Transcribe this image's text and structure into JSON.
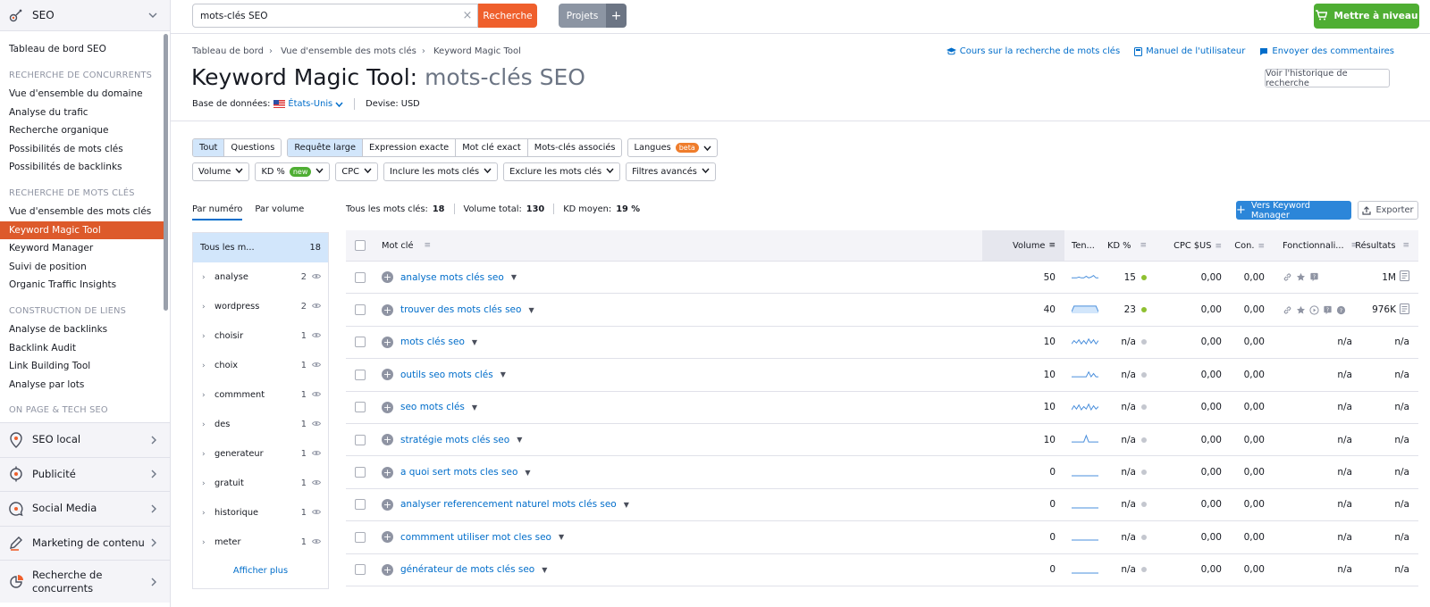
{
  "sidebar": {
    "top": {
      "title": "SEO"
    },
    "items": [
      {
        "type": "item",
        "label": "Tableau de bord SEO"
      },
      {
        "type": "cat",
        "label": "RECHERCHE DE CONCURRENTS"
      },
      {
        "type": "item",
        "label": "Vue d'ensemble du domaine"
      },
      {
        "type": "item",
        "label": "Analyse du trafic"
      },
      {
        "type": "item",
        "label": "Recherche organique"
      },
      {
        "type": "item",
        "label": "Possibilités de mots clés"
      },
      {
        "type": "item",
        "label": "Possibilités de backlinks"
      },
      {
        "type": "cat",
        "label": "RECHERCHE DE MOTS CLÉS"
      },
      {
        "type": "item",
        "label": "Vue d'ensemble des mots clés"
      },
      {
        "type": "item",
        "label": "Keyword Magic Tool",
        "active": true
      },
      {
        "type": "item",
        "label": "Keyword Manager"
      },
      {
        "type": "item",
        "label": "Suivi de position"
      },
      {
        "type": "item",
        "label": "Organic Traffic Insights"
      },
      {
        "type": "cat",
        "label": "CONSTRUCTION DE LIENS"
      },
      {
        "type": "item",
        "label": "Analyse de backlinks"
      },
      {
        "type": "item",
        "label": "Backlink Audit"
      },
      {
        "type": "item",
        "label": "Link Building Tool"
      },
      {
        "type": "item",
        "label": "Analyse par lots"
      },
      {
        "type": "cat",
        "label": "ON PAGE & TECH SEO"
      }
    ],
    "sections": [
      {
        "label": "SEO local",
        "icon": "location-pin-icon"
      },
      {
        "label": "Publicité",
        "icon": "target-icon"
      },
      {
        "label": "Social Media",
        "icon": "chat-bubble-icon"
      },
      {
        "label": "Marketing de contenu",
        "icon": "pen-icon"
      },
      {
        "label": "Recherche de concurrents",
        "icon": "pie-chart-icon"
      }
    ]
  },
  "topbar": {
    "search_value": "mots-clés SEO",
    "clear_symbol": "×",
    "search_button": "Recherche",
    "projects_button": "Projets",
    "projects_add": "+",
    "upgrade_button": "Mettre à niveau"
  },
  "breadcrumb": [
    "Tableau de bord",
    "Vue d'ensemble des mots clés",
    "Keyword Magic Tool"
  ],
  "help_links": [
    {
      "label": "Cours sur la recherche de mots clés"
    },
    {
      "label": "Manuel de l'utilisateur"
    },
    {
      "label": "Envoyer des commentaires"
    }
  ],
  "title": {
    "tool": "Keyword Magic Tool:",
    "query": "mots-clés SEO"
  },
  "history_button": "Voir l'historique de recherche",
  "database": {
    "label": "Base de données:",
    "value": "États-Unis",
    "currency": "Devise: USD"
  },
  "filters": {
    "match_group_1": [
      {
        "label": "Tout",
        "on": true
      },
      {
        "label": "Questions"
      }
    ],
    "match_group_2": [
      {
        "label": "Requête large",
        "on": true
      },
      {
        "label": "Expression exacte"
      },
      {
        "label": "Mot clé exact"
      },
      {
        "label": "Mots-clés associés"
      }
    ],
    "languages": {
      "label": "Langues",
      "badge": "beta"
    },
    "dropdowns": [
      {
        "label": "Volume"
      },
      {
        "label": "KD %",
        "badge": "new"
      },
      {
        "label": "CPC"
      },
      {
        "label": "Inclure les mots clés"
      },
      {
        "label": "Exclure les mots clés"
      },
      {
        "label": "Filtres avancés"
      }
    ]
  },
  "group_tabs": [
    {
      "label": "Par numéro",
      "on": true
    },
    {
      "label": "Par volume"
    }
  ],
  "groups": {
    "head": {
      "label": "Tous les m...",
      "count": "18"
    },
    "rows": [
      {
        "label": "analyse",
        "count": "2"
      },
      {
        "label": "wordpress",
        "count": "2"
      },
      {
        "label": "choisir",
        "count": "1"
      },
      {
        "label": "choix",
        "count": "1"
      },
      {
        "label": "commment",
        "count": "1"
      },
      {
        "label": "des",
        "count": "1"
      },
      {
        "label": "generateur",
        "count": "1"
      },
      {
        "label": "gratuit",
        "count": "1"
      },
      {
        "label": "historique",
        "count": "1"
      },
      {
        "label": "meter",
        "count": "1"
      }
    ],
    "more": "Afficher plus"
  },
  "summary": {
    "all_label": "Tous les mots clés:",
    "all_value": "18",
    "vol_label": "Volume total:",
    "vol_value": "130",
    "kd_label": "KD moyen:",
    "kd_value": "19 %"
  },
  "actions": {
    "keyword_manager": "Vers Keyword Manager",
    "export": "Exporter"
  },
  "table": {
    "headers": {
      "keyword": "Mot clé",
      "volume": "Volume",
      "trend": "Ten...",
      "kd": "KD %",
      "cpc": "CPC $US",
      "com": "Con.",
      "features": "Fonctionnali...",
      "results": "Résultats"
    },
    "rows": [
      {
        "keyword": "analyse mots clés seo",
        "volume": "50",
        "kd": "15",
        "kd_color": "green",
        "cpc": "0,00",
        "com": "0,00",
        "features": [
          "link-icon",
          "star-icon",
          "faq-icon"
        ],
        "results": "1M",
        "trend": [
          0.3,
          0.3,
          0.3,
          0.4,
          0.3,
          0.3,
          0.5,
          0.3,
          0.4,
          0.6,
          0.3,
          0.3
        ]
      },
      {
        "keyword": "trouver des mots clés seo",
        "volume": "40",
        "kd": "23",
        "kd_color": "green",
        "cpc": "0,00",
        "com": "0,00",
        "features": [
          "link-icon",
          "star-icon",
          "play-icon",
          "faq-icon",
          "question-icon"
        ],
        "results": "976K",
        "trend": [
          0.2,
          0.9,
          0.9,
          0.9,
          0.9,
          0.9,
          0.9,
          0.9,
          0.9,
          0.9,
          0.9,
          0.2
        ]
      },
      {
        "keyword": "mots clés seo",
        "volume": "10",
        "kd": "n/a",
        "kd_color": "none",
        "cpc": "0,00",
        "com": "0,00",
        "features": "n/a",
        "results": "n/a",
        "trend": [
          0.2,
          0.6,
          0.3,
          0.7,
          0.2,
          0.6,
          0.2,
          0.8,
          0.3,
          0.7,
          0.2,
          0.6
        ]
      },
      {
        "keyword": "outils seo mots clés",
        "volume": "10",
        "kd": "n/a",
        "kd_color": "none",
        "cpc": "0,00",
        "com": "0,00",
        "features": "n/a",
        "results": "n/a",
        "trend": [
          0.1,
          0.1,
          0.1,
          0.1,
          0.1,
          0.1,
          0.1,
          0.7,
          0.1,
          0.5,
          0.1,
          0.1
        ]
      },
      {
        "keyword": "seo mots clés",
        "volume": "10",
        "kd": "n/a",
        "kd_color": "none",
        "cpc": "0,00",
        "com": "0,00",
        "features": "n/a",
        "results": "n/a",
        "trend": [
          0.1,
          0.6,
          0.2,
          0.7,
          0.1,
          0.5,
          0.2,
          0.8,
          0.1,
          0.6,
          0.2,
          0.5
        ]
      },
      {
        "keyword": "stratégie mots clés seo",
        "volume": "10",
        "kd": "n/a",
        "kd_color": "none",
        "cpc": "0,00",
        "com": "0,00",
        "features": "n/a",
        "results": "n/a",
        "trend": [
          0.1,
          0.1,
          0.1,
          0.1,
          0.1,
          0.1,
          0.9,
          0.1,
          0.1,
          0.1,
          0.1,
          0.1
        ]
      },
      {
        "keyword": "a quoi sert mots cles seo",
        "volume": "0",
        "kd": "n/a",
        "kd_color": "none",
        "cpc": "0,00",
        "com": "0,00",
        "features": "n/a",
        "results": "n/a",
        "trend": [
          0,
          0,
          0,
          0,
          0,
          0,
          0,
          0,
          0,
          0,
          0,
          0
        ]
      },
      {
        "keyword": "analyser referencement naturel mots clés seo",
        "volume": "0",
        "kd": "n/a",
        "kd_color": "none",
        "cpc": "0,00",
        "com": "0,00",
        "features": "n/a",
        "results": "n/a",
        "trend": [
          0,
          0,
          0,
          0,
          0,
          0,
          0,
          0,
          0,
          0,
          0,
          0
        ]
      },
      {
        "keyword": "commment utiliser mot cles seo",
        "volume": "0",
        "kd": "n/a",
        "kd_color": "none",
        "cpc": "0,00",
        "com": "0,00",
        "features": "n/a",
        "results": "n/a",
        "trend": [
          0,
          0,
          0,
          0,
          0,
          0,
          0,
          0,
          0,
          0,
          0,
          0
        ]
      },
      {
        "keyword": "générateur de mots clés seo",
        "volume": "0",
        "kd": "n/a",
        "kd_color": "none",
        "cpc": "0,00",
        "com": "0,00",
        "features": "n/a",
        "results": "n/a",
        "trend": [
          0,
          0,
          0,
          0,
          0,
          0,
          0,
          0,
          0,
          0,
          0,
          0
        ]
      }
    ]
  },
  "colors": {
    "accent_orange": "#ef5f2c",
    "active_nav": "#dd5a2b",
    "link_blue": "#006dca",
    "upgrade_green": "#4fae33",
    "kd_green": "#8ec030",
    "trend_blue": "#4a8fdc"
  }
}
